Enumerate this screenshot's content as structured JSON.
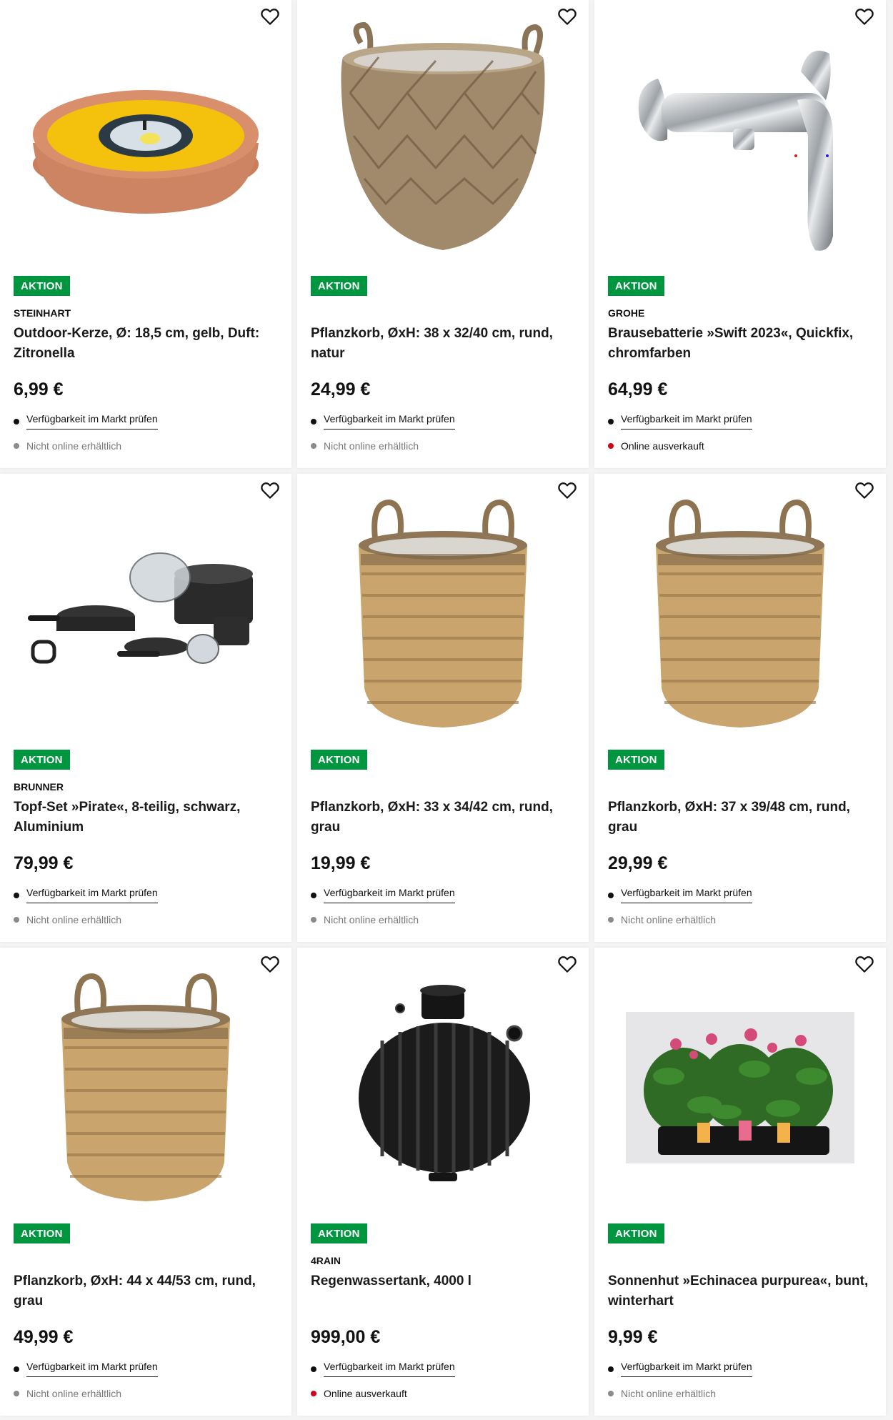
{
  "colors": {
    "badge": "#00963f",
    "sold_out_dot": "#d0021b",
    "unavailable_dot": "#8a8a8a",
    "avail_dot": "#111111"
  },
  "products": [
    {
      "badge": "AKTION",
      "brand": "STEINHART",
      "title": "Outdoor-Kerze, Ø: 18,5 cm, gelb, Duft: Zitronella",
      "price": "6,99 €",
      "availability": "Verfügbarkeit im Markt prüfen",
      "online_status": "Nicht online erhältlich",
      "online_state": "unavailable",
      "image": "candle-bowl"
    },
    {
      "badge": "AKTION",
      "brand": "",
      "title": "Pflanzkorb, ØxH: 38 x 32/40 cm, rund, natur",
      "price": "24,99 €",
      "availability": "Verfügbarkeit im Markt prüfen",
      "online_status": "Nicht online erhältlich",
      "online_state": "unavailable",
      "image": "round-wicker-basket"
    },
    {
      "badge": "AKTION",
      "brand": "GROHE",
      "title": "Brausebatterie »Swift 2023«, Quickfix, chromfarben",
      "price": "64,99 €",
      "availability": "Verfügbarkeit im Markt prüfen",
      "online_status": "Online ausverkauft",
      "online_state": "soldout",
      "image": "shower-mixer"
    },
    {
      "badge": "AKTION",
      "brand": "BRUNNER",
      "title": "Topf-Set »Pirate«, 8-teilig, schwarz, Aluminium",
      "price": "79,99 €",
      "availability": "Verfügbarkeit im Markt prüfen",
      "online_status": "Nicht online erhältlich",
      "online_state": "unavailable",
      "image": "pot-set"
    },
    {
      "badge": "AKTION",
      "brand": "",
      "title": "Pflanzkorb, ØxH: 33 x 34/42 cm, rund, grau",
      "price": "19,99 €",
      "availability": "Verfügbarkeit im Markt prüfen",
      "online_status": "Nicht online erhältlich",
      "online_state": "unavailable",
      "image": "tall-wicker-basket"
    },
    {
      "badge": "AKTION",
      "brand": "",
      "title": "Pflanzkorb, ØxH: 37 x 39/48 cm, rund, grau",
      "price": "29,99 €",
      "availability": "Verfügbarkeit im Markt prüfen",
      "online_status": "Nicht online erhältlich",
      "online_state": "unavailable",
      "image": "tall-wicker-basket"
    },
    {
      "badge": "AKTION",
      "brand": "",
      "title": "Pflanzkorb, ØxH: 44 x 44/53 cm, rund, grau",
      "price": "49,99 €",
      "availability": "Verfügbarkeit im Markt prüfen",
      "online_status": "Nicht online erhältlich",
      "online_state": "unavailable",
      "image": "tall-wicker-basket"
    },
    {
      "badge": "AKTION",
      "brand": "4RAIN",
      "title": "Regenwassertank, 4000 l",
      "price": "999,00 €",
      "availability": "Verfügbarkeit im Markt prüfen",
      "online_status": "Online ausverkauft",
      "online_state": "soldout",
      "image": "rain-tank"
    },
    {
      "badge": "AKTION",
      "brand": "",
      "title": "Sonnenhut »Echinacea purpurea«, bunt, winterhart",
      "price": "9,99 €",
      "availability": "Verfügbarkeit im Markt prüfen",
      "online_status": "Nicht online erhältlich",
      "online_state": "unavailable",
      "image": "echinacea-plants"
    }
  ]
}
